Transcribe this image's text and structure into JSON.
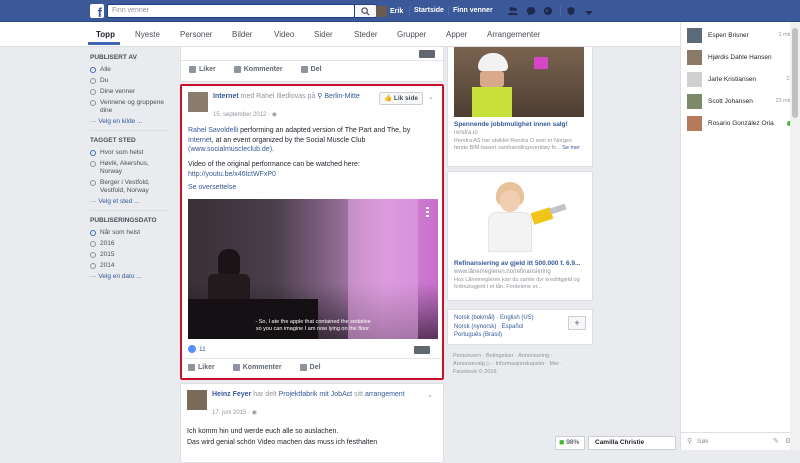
{
  "topbar": {
    "search_placeholder": "Finn venner",
    "user": "Erik",
    "home": "Startside",
    "find_friends": "Finn venner"
  },
  "tabs": [
    "Topp",
    "Nyeste",
    "Personer",
    "Bilder",
    "Video",
    "Sider",
    "Steder",
    "Grupper",
    "Apper",
    "Arrangementer"
  ],
  "filters": {
    "published_by": {
      "title": "PUBLISERT AV",
      "options": [
        "Alle",
        "Du",
        "Dine venner",
        "Vennene og gruppene dine"
      ],
      "more": "Velg en kilde ..."
    },
    "tagged_place": {
      "title": "TAGGET STED",
      "options": [
        "Hvor som helst",
        "Høvik, Akershus, Norway",
        "Berger i Vestfold, Vestfold, Norway"
      ],
      "more": "Velg et sted ..."
    },
    "date": {
      "title": "PUBLISERINGSDATO",
      "options": [
        "Når som helst",
        "2016",
        "2015",
        "2014"
      ],
      "more": "Velg en dato ..."
    }
  },
  "feed": {
    "prev_actions": {
      "like": "Liker",
      "comment": "Kommenter",
      "share": "Del"
    },
    "post1": {
      "author": "Internet",
      "with_text": "med Rahel Illedlovas på",
      "location": "Berlin-Mitte",
      "date": "15. september 2012 ·",
      "like_page": "Lik side",
      "text_name": "Rahel Savoldelli",
      "text_1": " performing an adapted version of The Part and The, by ",
      "text_link1": "Internet",
      "text_2": ", at an event organized by the Social Muscle Club ",
      "text_link2": "(www.socialmuscleclub.de)",
      "text_3": ".",
      "video_text": "Video of the original performance can be watched here: ",
      "video_link": "http://youtu.be/x46tctWFxP0",
      "translate": "Se oversettelse",
      "subtitle1": "- So, I ate the apple that contained the sedative",
      "subtitle2": "so you can imagine I am now lying on the floor.",
      "likes": "11",
      "like": "Liker",
      "comment": "Kommenter",
      "share": "Del"
    },
    "post2": {
      "author": "Heinz Feyer",
      "shared_text": "har delt",
      "shared_link": "Projektfabrik mit JobAct",
      "tail": "sitt",
      "event": "arrangement",
      "date": "17. juni 2015 ·",
      "line1": "Ich komm hin und werde euch alle so auslachen.",
      "line2": "Das wird genial schön Video machen das muss ich festhalten"
    }
  },
  "ads": {
    "ad1": {
      "title": "Spennende jobbmulighet innen salg!",
      "domain": "rendra.io",
      "desc": "Rendra AS har utviklet Rendra O som er Norges første BIM-basert samhandlingsverktøy fo...",
      "more": "Se mer"
    },
    "ad2": {
      "title": "Refinansiering av gjeld itt 500.000 f. 6.9...",
      "domain": "www.lånemegleren.no/refinansiering",
      "desc": "Hos Lånemegleren kan du samle dyr kredittgjeld og forbruksgjeld i et lån. Fordelene er..."
    }
  },
  "languages": {
    "items": [
      "Norsk (bokmål) · English (US)",
      "Norsk (nynorsk) · Español",
      "Português (Brasil)"
    ]
  },
  "footer": {
    "line1": "Personvern · Betingelser · Annonsering ·",
    "line2": "Annonsevalg ▷ · Informasjonskapsler · Mer ·",
    "line3": "Facebook © 2016"
  },
  "chat": {
    "contacts": [
      {
        "name": "Espen Brisner",
        "time": "1 min"
      },
      {
        "name": "Hjørdis Dahle Hansen",
        "time": ""
      },
      {
        "name": "Jarle Kristiansen",
        "time": "11"
      },
      {
        "name": "Scott Johansen",
        "time": "23 min"
      },
      {
        "name": "Rosario González Oria",
        "time": "dot"
      }
    ],
    "search_placeholder": "Søk",
    "bottom_user": "Camilla Christie",
    "battery": "98%"
  }
}
